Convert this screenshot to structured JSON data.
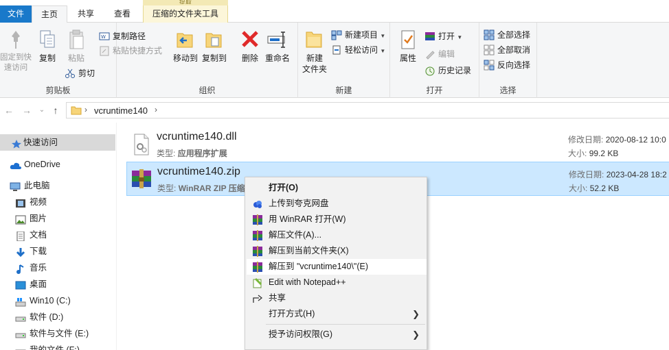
{
  "tabs": {
    "file": "文件",
    "home": "主页",
    "share": "共享",
    "view": "查看",
    "context_header": "提取",
    "context": "压缩的文件夹工具"
  },
  "ribbon": {
    "pin": "固定到快\n速访问",
    "copy": "复制",
    "paste": "粘贴",
    "copy_path": "复制路径",
    "paste_shortcut": "粘贴快捷方式",
    "cut": "剪切",
    "clipboard": "剪贴板",
    "move_to": "移动到",
    "copy_to": "复制到",
    "delete": "删除",
    "rename": "重命名",
    "organize": "组织",
    "new_folder": "新建\n文件夹",
    "new_item": "新建项目",
    "easy_access": "轻松访问",
    "new_group": "新建",
    "properties": "属性",
    "open": "打开",
    "edit": "编辑",
    "history": "历史记录",
    "open_group": "打开",
    "select_all": "全部选择",
    "select_none": "全部取消",
    "invert": "反向选择",
    "select_group": "选择"
  },
  "address": {
    "crumb": "vcruntime140"
  },
  "nav": {
    "items": [
      {
        "label": "快速访问",
        "icon": "star-icon"
      },
      {
        "label": "OneDrive",
        "icon": "cloud-icon"
      },
      {
        "label": "此电脑",
        "icon": "computer-icon"
      },
      {
        "label": "视频",
        "icon": "video-icon"
      },
      {
        "label": "图片",
        "icon": "picture-icon"
      },
      {
        "label": "文档",
        "icon": "document-icon"
      },
      {
        "label": "下载",
        "icon": "download-icon"
      },
      {
        "label": "音乐",
        "icon": "music-icon"
      },
      {
        "label": "桌面",
        "icon": "desktop-icon"
      },
      {
        "label": "Win10 (C:)",
        "icon": "drive-icon"
      },
      {
        "label": "软件 (D:)",
        "icon": "drive-icon"
      },
      {
        "label": "软件与文件 (E:)",
        "icon": "drive-icon"
      },
      {
        "label": "我的文件 (F:)",
        "icon": "drive-icon"
      }
    ]
  },
  "files": [
    {
      "name": "vcruntime140.dll",
      "type_label": "类型:",
      "type": "应用程序扩展",
      "date_label": "修改日期:",
      "date": "2020-08-12 10:0",
      "size_label": "大小:",
      "size": "99.2 KB",
      "icon": "dll-file-icon"
    },
    {
      "name": "vcruntime140.zip",
      "type_label": "类型:",
      "type": "WinRAR ZIP 压缩",
      "date_label": "修改日期:",
      "date": "2023-04-28 18:2",
      "size_label": "大小:",
      "size": "52.2 KB",
      "icon": "winrar-archive-icon"
    }
  ],
  "menu": {
    "items": [
      {
        "label": "打开(O)"
      },
      {
        "label": "上传到夸克网盘"
      },
      {
        "label": "用 WinRAR 打开(W)"
      },
      {
        "label": "解压文件(A)..."
      },
      {
        "label": "解压到当前文件夹(X)"
      },
      {
        "label": "解压到 \"vcruntime140\\\"(E)"
      },
      {
        "label": "Edit with Notepad++"
      },
      {
        "label": "共享"
      },
      {
        "label": "打开方式(H)"
      },
      {
        "label": "授予访问权限(G)"
      }
    ]
  },
  "colors": {
    "accent": "#1979ca",
    "selection": "#cce8ff",
    "selection_border": "#99d1ff",
    "context_tab": "#fcf6d9"
  }
}
